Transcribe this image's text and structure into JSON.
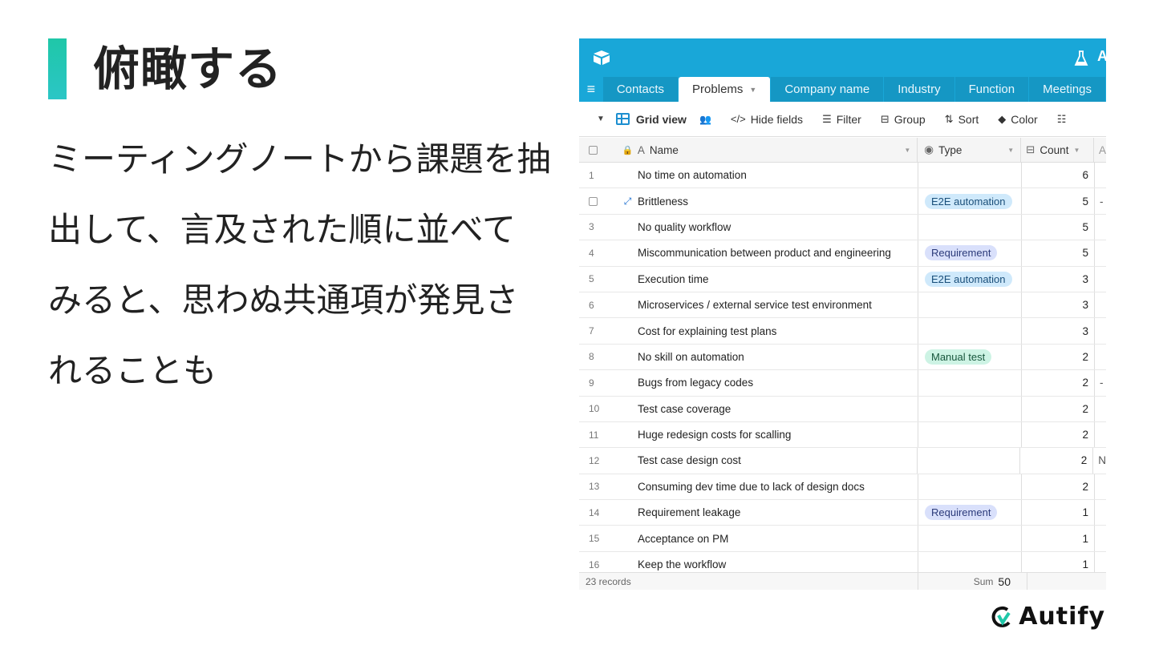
{
  "slide": {
    "title": "俯瞰する",
    "body_lines": [
      "ミーティングノートから課題を抽",
      "出して、言及された順に並べて",
      "みると、思わぬ共通項が発見さ",
      "れることも"
    ]
  },
  "app": {
    "user_initial": "A",
    "tabs": [
      {
        "label": "Contacts"
      },
      {
        "label": "Problems"
      },
      {
        "label": "Company name"
      },
      {
        "label": "Industry"
      },
      {
        "label": "Function"
      },
      {
        "label": "Meetings"
      }
    ],
    "toolbar": {
      "view_name": "Grid view",
      "hide_fields": "Hide fields",
      "filter": "Filter",
      "group": "Group",
      "sort": "Sort",
      "color": "Color"
    },
    "columns": {
      "name": "Name",
      "type": "Type",
      "count": "Count"
    },
    "rows": [
      {
        "num": "1",
        "name": "No time on automation",
        "type": "",
        "type_color": "",
        "count": "6",
        "extra": ""
      },
      {
        "num": "",
        "name": "Brittleness",
        "type": "E2E automation",
        "type_color": "blue",
        "count": "5",
        "extra": "-"
      },
      {
        "num": "3",
        "name": "No quality workflow",
        "type": "",
        "type_color": "",
        "count": "5",
        "extra": ""
      },
      {
        "num": "4",
        "name": "Miscommunication between product and engineering",
        "type": "Requirement",
        "type_color": "purple",
        "count": "5",
        "extra": ""
      },
      {
        "num": "5",
        "name": "Execution time",
        "type": "E2E automation",
        "type_color": "blue",
        "count": "3",
        "extra": ""
      },
      {
        "num": "6",
        "name": "Microservices / external service test environment",
        "type": "",
        "type_color": "",
        "count": "3",
        "extra": ""
      },
      {
        "num": "7",
        "name": "Cost for explaining test plans",
        "type": "",
        "type_color": "",
        "count": "3",
        "extra": ""
      },
      {
        "num": "8",
        "name": "No skill on automation",
        "type": "Manual test",
        "type_color": "green",
        "count": "2",
        "extra": ""
      },
      {
        "num": "9",
        "name": "Bugs from legacy codes",
        "type": "",
        "type_color": "",
        "count": "2",
        "extra": "-"
      },
      {
        "num": "10",
        "name": "Test case coverage",
        "type": "",
        "type_color": "",
        "count": "2",
        "extra": ""
      },
      {
        "num": "11",
        "name": "Huge redesign costs for scalling",
        "type": "",
        "type_color": "",
        "count": "2",
        "extra": ""
      },
      {
        "num": "12",
        "name": "Test case design cost",
        "type": "",
        "type_color": "",
        "count": "2",
        "extra": "N"
      },
      {
        "num": "13",
        "name": "Consuming dev time due to lack of design docs",
        "type": "",
        "type_color": "",
        "count": "2",
        "extra": ""
      },
      {
        "num": "14",
        "name": "Requirement leakage",
        "type": "Requirement",
        "type_color": "purple",
        "count": "1",
        "extra": ""
      },
      {
        "num": "15",
        "name": "Acceptance on PM",
        "type": "",
        "type_color": "",
        "count": "1",
        "extra": ""
      },
      {
        "num": "16",
        "name": "Keep the workflow",
        "type": "",
        "type_color": "",
        "count": "1",
        "extra": ""
      }
    ],
    "footer": {
      "records": "23 records",
      "sum_label": "Sum",
      "sum_value": "50"
    }
  },
  "brand": {
    "name": "Autify"
  },
  "colors": {
    "accent": "#1fc7a8",
    "topbar": "#19a7d8"
  }
}
